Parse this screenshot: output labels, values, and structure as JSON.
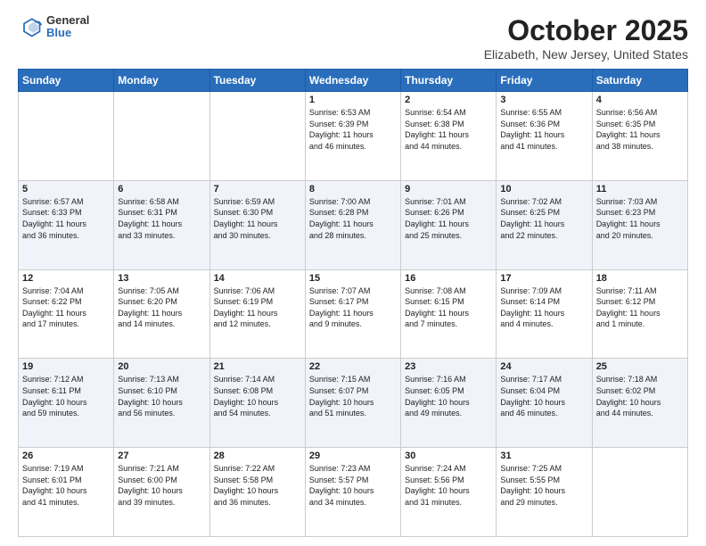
{
  "header": {
    "logo_line1": "General",
    "logo_line2": "Blue",
    "title": "October 2025",
    "subtitle": "Elizabeth, New Jersey, United States"
  },
  "days_of_week": [
    "Sunday",
    "Monday",
    "Tuesday",
    "Wednesday",
    "Thursday",
    "Friday",
    "Saturday"
  ],
  "weeks": [
    [
      {
        "day": "",
        "info": ""
      },
      {
        "day": "",
        "info": ""
      },
      {
        "day": "",
        "info": ""
      },
      {
        "day": "1",
        "info": "Sunrise: 6:53 AM\nSunset: 6:39 PM\nDaylight: 11 hours\nand 46 minutes."
      },
      {
        "day": "2",
        "info": "Sunrise: 6:54 AM\nSunset: 6:38 PM\nDaylight: 11 hours\nand 44 minutes."
      },
      {
        "day": "3",
        "info": "Sunrise: 6:55 AM\nSunset: 6:36 PM\nDaylight: 11 hours\nand 41 minutes."
      },
      {
        "day": "4",
        "info": "Sunrise: 6:56 AM\nSunset: 6:35 PM\nDaylight: 11 hours\nand 38 minutes."
      }
    ],
    [
      {
        "day": "5",
        "info": "Sunrise: 6:57 AM\nSunset: 6:33 PM\nDaylight: 11 hours\nand 36 minutes."
      },
      {
        "day": "6",
        "info": "Sunrise: 6:58 AM\nSunset: 6:31 PM\nDaylight: 11 hours\nand 33 minutes."
      },
      {
        "day": "7",
        "info": "Sunrise: 6:59 AM\nSunset: 6:30 PM\nDaylight: 11 hours\nand 30 minutes."
      },
      {
        "day": "8",
        "info": "Sunrise: 7:00 AM\nSunset: 6:28 PM\nDaylight: 11 hours\nand 28 minutes."
      },
      {
        "day": "9",
        "info": "Sunrise: 7:01 AM\nSunset: 6:26 PM\nDaylight: 11 hours\nand 25 minutes."
      },
      {
        "day": "10",
        "info": "Sunrise: 7:02 AM\nSunset: 6:25 PM\nDaylight: 11 hours\nand 22 minutes."
      },
      {
        "day": "11",
        "info": "Sunrise: 7:03 AM\nSunset: 6:23 PM\nDaylight: 11 hours\nand 20 minutes."
      }
    ],
    [
      {
        "day": "12",
        "info": "Sunrise: 7:04 AM\nSunset: 6:22 PM\nDaylight: 11 hours\nand 17 minutes."
      },
      {
        "day": "13",
        "info": "Sunrise: 7:05 AM\nSunset: 6:20 PM\nDaylight: 11 hours\nand 14 minutes."
      },
      {
        "day": "14",
        "info": "Sunrise: 7:06 AM\nSunset: 6:19 PM\nDaylight: 11 hours\nand 12 minutes."
      },
      {
        "day": "15",
        "info": "Sunrise: 7:07 AM\nSunset: 6:17 PM\nDaylight: 11 hours\nand 9 minutes."
      },
      {
        "day": "16",
        "info": "Sunrise: 7:08 AM\nSunset: 6:15 PM\nDaylight: 11 hours\nand 7 minutes."
      },
      {
        "day": "17",
        "info": "Sunrise: 7:09 AM\nSunset: 6:14 PM\nDaylight: 11 hours\nand 4 minutes."
      },
      {
        "day": "18",
        "info": "Sunrise: 7:11 AM\nSunset: 6:12 PM\nDaylight: 11 hours\nand 1 minute."
      }
    ],
    [
      {
        "day": "19",
        "info": "Sunrise: 7:12 AM\nSunset: 6:11 PM\nDaylight: 10 hours\nand 59 minutes."
      },
      {
        "day": "20",
        "info": "Sunrise: 7:13 AM\nSunset: 6:10 PM\nDaylight: 10 hours\nand 56 minutes."
      },
      {
        "day": "21",
        "info": "Sunrise: 7:14 AM\nSunset: 6:08 PM\nDaylight: 10 hours\nand 54 minutes."
      },
      {
        "day": "22",
        "info": "Sunrise: 7:15 AM\nSunset: 6:07 PM\nDaylight: 10 hours\nand 51 minutes."
      },
      {
        "day": "23",
        "info": "Sunrise: 7:16 AM\nSunset: 6:05 PM\nDaylight: 10 hours\nand 49 minutes."
      },
      {
        "day": "24",
        "info": "Sunrise: 7:17 AM\nSunset: 6:04 PM\nDaylight: 10 hours\nand 46 minutes."
      },
      {
        "day": "25",
        "info": "Sunrise: 7:18 AM\nSunset: 6:02 PM\nDaylight: 10 hours\nand 44 minutes."
      }
    ],
    [
      {
        "day": "26",
        "info": "Sunrise: 7:19 AM\nSunset: 6:01 PM\nDaylight: 10 hours\nand 41 minutes."
      },
      {
        "day": "27",
        "info": "Sunrise: 7:21 AM\nSunset: 6:00 PM\nDaylight: 10 hours\nand 39 minutes."
      },
      {
        "day": "28",
        "info": "Sunrise: 7:22 AM\nSunset: 5:58 PM\nDaylight: 10 hours\nand 36 minutes."
      },
      {
        "day": "29",
        "info": "Sunrise: 7:23 AM\nSunset: 5:57 PM\nDaylight: 10 hours\nand 34 minutes."
      },
      {
        "day": "30",
        "info": "Sunrise: 7:24 AM\nSunset: 5:56 PM\nDaylight: 10 hours\nand 31 minutes."
      },
      {
        "day": "31",
        "info": "Sunrise: 7:25 AM\nSunset: 5:55 PM\nDaylight: 10 hours\nand 29 minutes."
      },
      {
        "day": "",
        "info": ""
      }
    ]
  ]
}
